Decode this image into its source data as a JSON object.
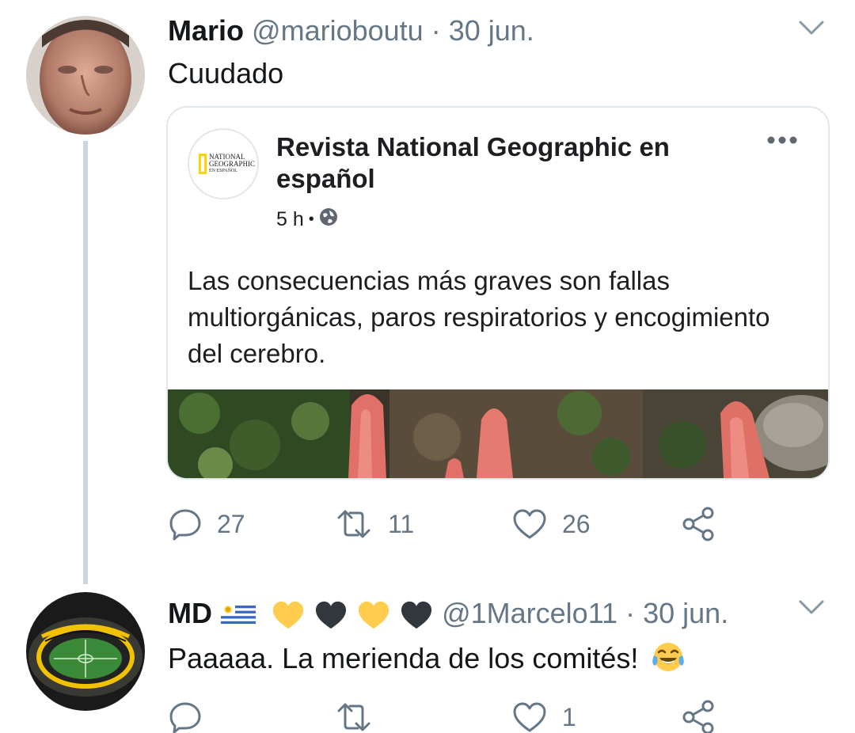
{
  "tweets": [
    {
      "author_name": "Mario",
      "handle": "@marioboutu",
      "separator": "·",
      "date": "30 jun.",
      "text": "Cuudado",
      "embedded_post": {
        "page_name": "Revista National Geographic en español",
        "logo_text_line1": "NATIONAL",
        "logo_text_line2": "GEOGRAPHIC",
        "logo_text_line3": "EN ESPAÑOL",
        "time": "5 h",
        "meta_separator": "•",
        "body": "Las consecuencias más graves son fallas multiorgánicas, paros respiratorios y encogimiento del cerebro."
      },
      "actions": {
        "replies": "27",
        "retweets": "11",
        "likes": "26"
      }
    },
    {
      "author_name": "MD",
      "handle": "@1Marcelo11",
      "separator": "·",
      "date": "30 jun.",
      "text": "Paaaaa. La merienda de los comités!",
      "actions": {
        "replies": "",
        "retweets": "",
        "likes": "1"
      }
    }
  ],
  "icons": {
    "reply": "speech-bubble-icon",
    "retweet": "retweet-arrows-icon",
    "like": "heart-outline-icon",
    "share": "share-nodes-icon",
    "caret": "chevron-down-icon",
    "globe": "globe-icon",
    "more": "more-dots-icon"
  },
  "colors": {
    "secondary_text": "#657786",
    "divider": "#ccd6dd",
    "heart_yellow": "#ffcc4d",
    "heart_black": "#31373d"
  }
}
